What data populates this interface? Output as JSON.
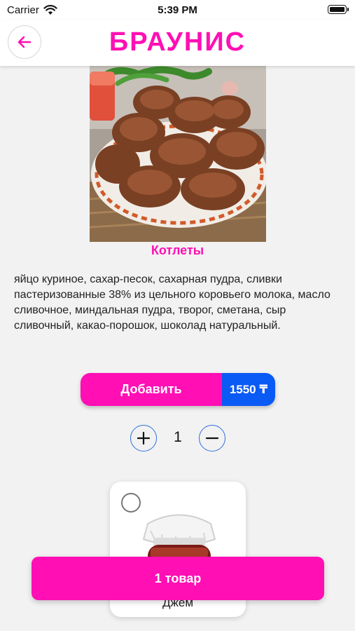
{
  "status_bar": {
    "carrier": "Carrier",
    "time": "5:39 PM"
  },
  "header": {
    "logo_text": "БРАУНИС",
    "back_icon": "arrow-left-icon"
  },
  "product": {
    "image": "cutlets-photo",
    "title": "Котлеты",
    "description": "яйцо куриное, сахар-песок, сахарная пудра, сливки пастеризованные 38% из цельного коровьего молока, масло сливочное, миндальная пудра, творог, сметана, сыр сливочный, какао-порошок, шоколад натуральный."
  },
  "actions": {
    "add_label": "Добавить",
    "price": "1550 ₸"
  },
  "quantity": {
    "value": "1",
    "plus_icon": "plus-icon",
    "minus_icon": "minus-icon"
  },
  "addons": [
    {
      "label": "Джем",
      "image": "jam-jar-photo",
      "selected": false
    }
  ],
  "cart": {
    "label": "1 товар"
  },
  "colors": {
    "brand": "#ff0fb4",
    "price_bg": "#0a5af5",
    "accent_outline": "#2f6fe0",
    "background": "#f2f2f2"
  }
}
